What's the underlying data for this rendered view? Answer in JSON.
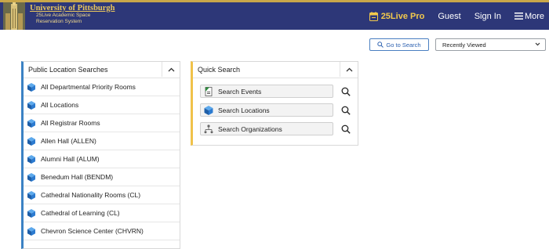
{
  "header": {
    "logo": {
      "university": "University of Pittsburgh",
      "line1": "25Live Academic Space",
      "line2": "Reservation System"
    },
    "brand": "25Live Pro",
    "nav": {
      "guest": "Guest",
      "sign_in": "Sign In",
      "more": "More"
    },
    "colors": {
      "bar": "#2d3778",
      "accent": "#c9a74a",
      "brand": "#f2c94c"
    }
  },
  "controls": {
    "goto_search": "Go to Search",
    "recently_viewed": "Recently Viewed"
  },
  "public_searches": {
    "title": "Public Location Searches",
    "items": [
      "All Departmental Priority Rooms",
      "All Locations",
      "All Registrar Rooms",
      "Allen Hall (ALLEN)",
      "Alumni Hall (ALUM)",
      "Benedum Hall (BENDM)",
      "Cathedral Nationality Rooms (CL)",
      "Cathedral of Learning (CL)",
      "Chevron Science Center (CHVRN)"
    ]
  },
  "quick_search": {
    "title": "Quick Search",
    "items": [
      {
        "label": "Search Events",
        "icon": "events-icon"
      },
      {
        "label": "Search Locations",
        "icon": "locations-cube-icon"
      },
      {
        "label": "Search Organizations",
        "icon": "organizations-icon"
      }
    ]
  }
}
